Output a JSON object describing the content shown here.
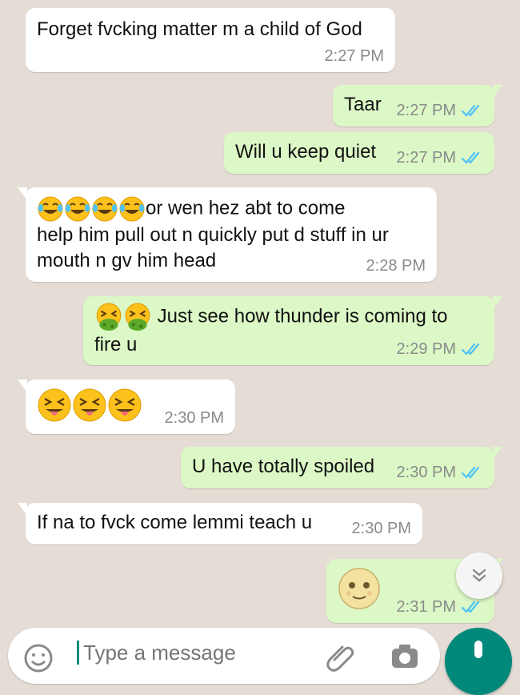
{
  "messages": [
    {
      "id": "m1",
      "dir": "in",
      "text": "Forget fvcking matter m a child of God",
      "time": "2:27 PM"
    },
    {
      "id": "m2",
      "dir": "out",
      "text": "Taar",
      "time": "2:27 PM"
    },
    {
      "id": "m3",
      "dir": "out",
      "text": "Will u keep quiet",
      "time": "2:27 PM"
    },
    {
      "id": "m4",
      "dir": "in",
      "line1": "or wen hez abt to come",
      "line2": "help him pull out n quickly put d stuff in ur",
      "line3": "mouth n gv him head",
      "time": "2:28 PM"
    },
    {
      "id": "m5",
      "dir": "out",
      "line1": "Just see how thunder is coming to",
      "line2": "fire u",
      "time": "2:29 PM"
    },
    {
      "id": "m6",
      "dir": "in",
      "time": "2:30 PM"
    },
    {
      "id": "m7",
      "dir": "out",
      "text": "U have totally spoiled",
      "time": "2:30 PM"
    },
    {
      "id": "m8",
      "dir": "in",
      "text": "If na to fvck come lemmi teach u",
      "time": "2:30 PM"
    },
    {
      "id": "m9",
      "dir": "out",
      "time": "2:31 PM"
    }
  ],
  "input": {
    "placeholder": "Type a message"
  },
  "icons": {
    "emoji_button": "smiley-icon",
    "attach": "paperclip-icon",
    "camera": "camera-icon",
    "mic": "microphone-icon",
    "scroll": "chevron-double-down-icon"
  },
  "colors": {
    "incoming": "#ffffff",
    "outgoing": "#dcf8c6",
    "background": "#e5ddd5",
    "read_ticks": "#4fc3f7",
    "accent": "#00897b"
  }
}
